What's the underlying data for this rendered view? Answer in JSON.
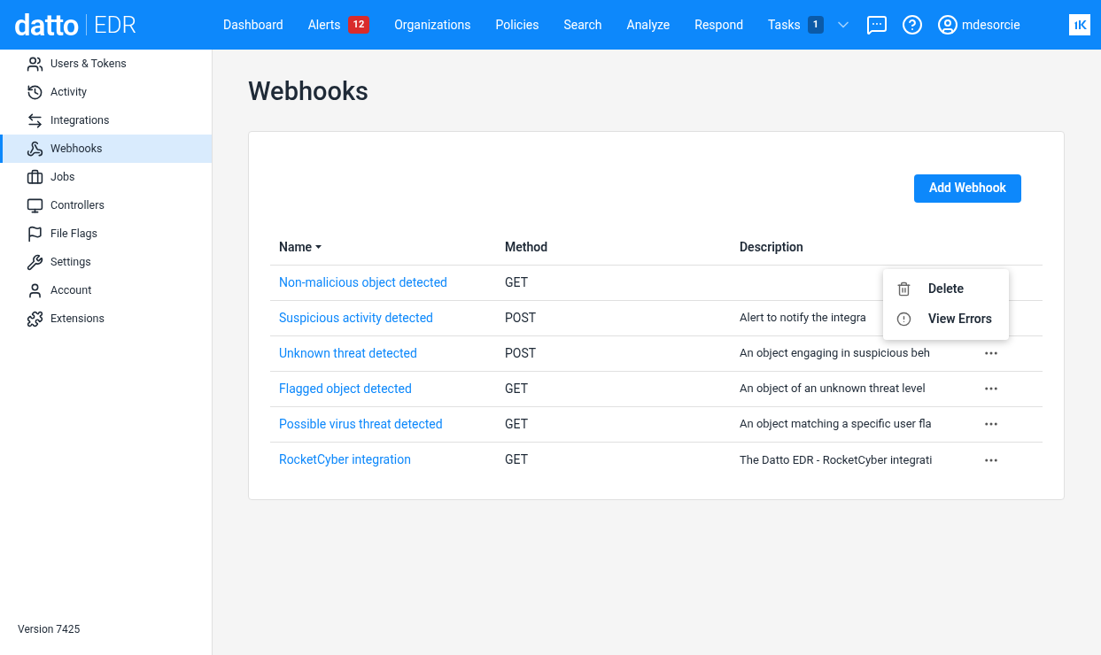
{
  "logo": {
    "brand": "datto",
    "product": "EDR"
  },
  "nav": [
    {
      "label": "Dashboard"
    },
    {
      "label": "Alerts",
      "badge": "12"
    },
    {
      "label": "Organizations"
    },
    {
      "label": "Policies"
    },
    {
      "label": "Search"
    },
    {
      "label": "Analyze"
    },
    {
      "label": "Respond"
    },
    {
      "label": "Tasks",
      "badge": "1"
    }
  ],
  "user": {
    "name": "mdesorcie"
  },
  "sidebar": {
    "items": [
      {
        "label": "Users & Tokens",
        "selected": false
      },
      {
        "label": "Activity",
        "selected": false
      },
      {
        "label": "Integrations",
        "selected": false
      },
      {
        "label": "Webhooks",
        "selected": true
      },
      {
        "label": "Jobs",
        "selected": false
      },
      {
        "label": "Controllers",
        "selected": false
      },
      {
        "label": "File Flags",
        "selected": false
      },
      {
        "label": "Settings",
        "selected": false
      },
      {
        "label": "Account",
        "selected": false
      },
      {
        "label": "Extensions",
        "selected": false
      }
    ],
    "version": "Version 7425"
  },
  "page_title": "Webhooks",
  "add_button": "Add Webhook",
  "table": {
    "columns": [
      "Name",
      "Method",
      "Description"
    ],
    "rows": [
      {
        "name": "Non-malicious object detected",
        "method": "GET",
        "description": ""
      },
      {
        "name": "Suspicious activity detected",
        "method": "POST",
        "description": "Alert to notify the integra"
      },
      {
        "name": "Unknown threat detected",
        "method": "POST",
        "description": "An object engaging in suspicious beh"
      },
      {
        "name": "Flagged object detected",
        "method": "GET",
        "description": "An object of an unknown threat level"
      },
      {
        "name": "Possible virus threat detected",
        "method": "GET",
        "description": "An object matching a specific user fla"
      },
      {
        "name": "RocketCyber integration",
        "method": "GET",
        "description": "The Datto EDR - RocketCyber integrati"
      }
    ]
  },
  "context_menu": [
    {
      "label": "Delete"
    },
    {
      "label": "View Errors"
    }
  ]
}
